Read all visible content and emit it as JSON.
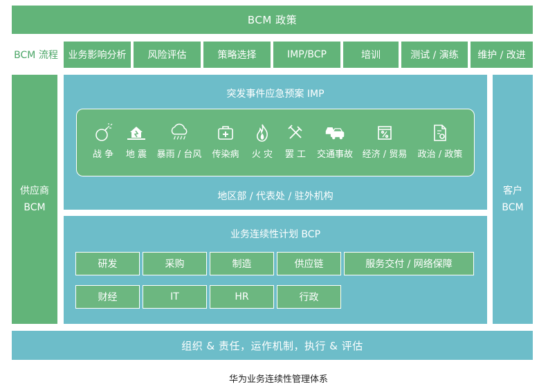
{
  "policy": "BCM 政策",
  "process": {
    "label": "BCM 流程",
    "steps": [
      "业务影响分析",
      "风险评估",
      "策略选择",
      "IMP/BCP",
      "培训",
      "测试 / 演练",
      "维护 / 改进"
    ]
  },
  "supplier": [
    "供应商",
    "BCM"
  ],
  "customer": [
    "客户",
    "BCM"
  ],
  "imp": {
    "title": "突发事件应急预案  IMP",
    "risks": [
      {
        "label": "战 争",
        "icon": "bomb-icon"
      },
      {
        "label": "地 震",
        "icon": "earthquake-house-icon"
      },
      {
        "label": "暴雨 / 台风",
        "icon": "storm-cloud-icon"
      },
      {
        "label": "传染病",
        "icon": "first-aid-kit-icon"
      },
      {
        "label": "火 灾",
        "icon": "fire-icon"
      },
      {
        "label": "罢 工",
        "icon": "crossed-tools-icon"
      },
      {
        "label": "交通事故",
        "icon": "car-crash-icon"
      },
      {
        "label": "经济 / 贸易",
        "icon": "percent-calendar-icon"
      },
      {
        "label": "政治 / 政策",
        "icon": "policy-document-icon"
      }
    ],
    "footer": "地区部 / 代表处 / 驻外机构"
  },
  "bcp": {
    "title": "业务连续性计划  BCP",
    "row1": [
      "研发",
      "采购",
      "制造",
      "供应链",
      "服务交付 / 网络保障"
    ],
    "row2": [
      "财经",
      "IT",
      "HR",
      "行政"
    ]
  },
  "bottom": "组织 & 责任，运作机制，执行 & 评估",
  "caption": "华为业务连续性管理体系",
  "colors": {
    "green": "#62b479",
    "teal": "#6dbdc9",
    "label_green": "#4aa566"
  }
}
